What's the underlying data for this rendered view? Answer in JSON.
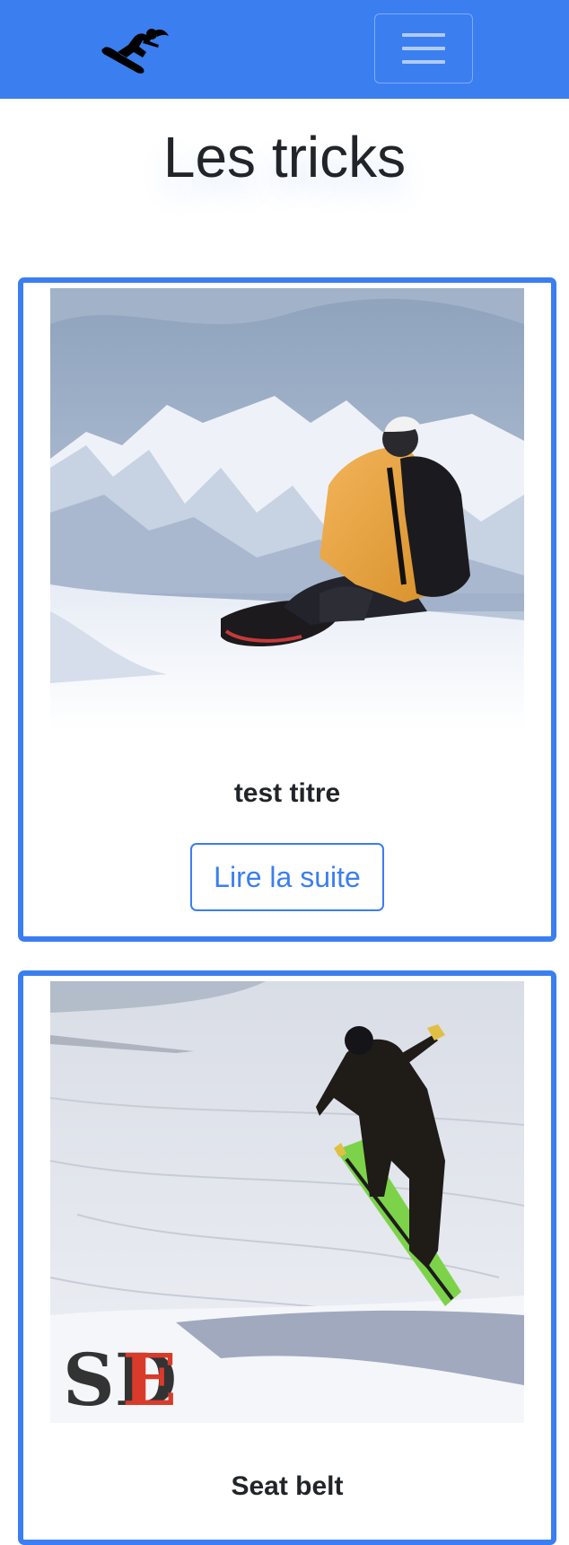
{
  "navbar": {
    "brand_color": "#3b7ef0",
    "logo_icon": "snowboarder-icon",
    "menu_icon": "hamburger-menu-icon"
  },
  "page": {
    "title": "Les tricks"
  },
  "tricks": [
    {
      "title": "test titre",
      "image_icon": "snowboarder-sitting-photo",
      "button_label": "Lire la suite"
    },
    {
      "title": "Seat belt",
      "image_icon": "snowboarder-jump-photo",
      "image_watermark": "SDE"
    }
  ]
}
